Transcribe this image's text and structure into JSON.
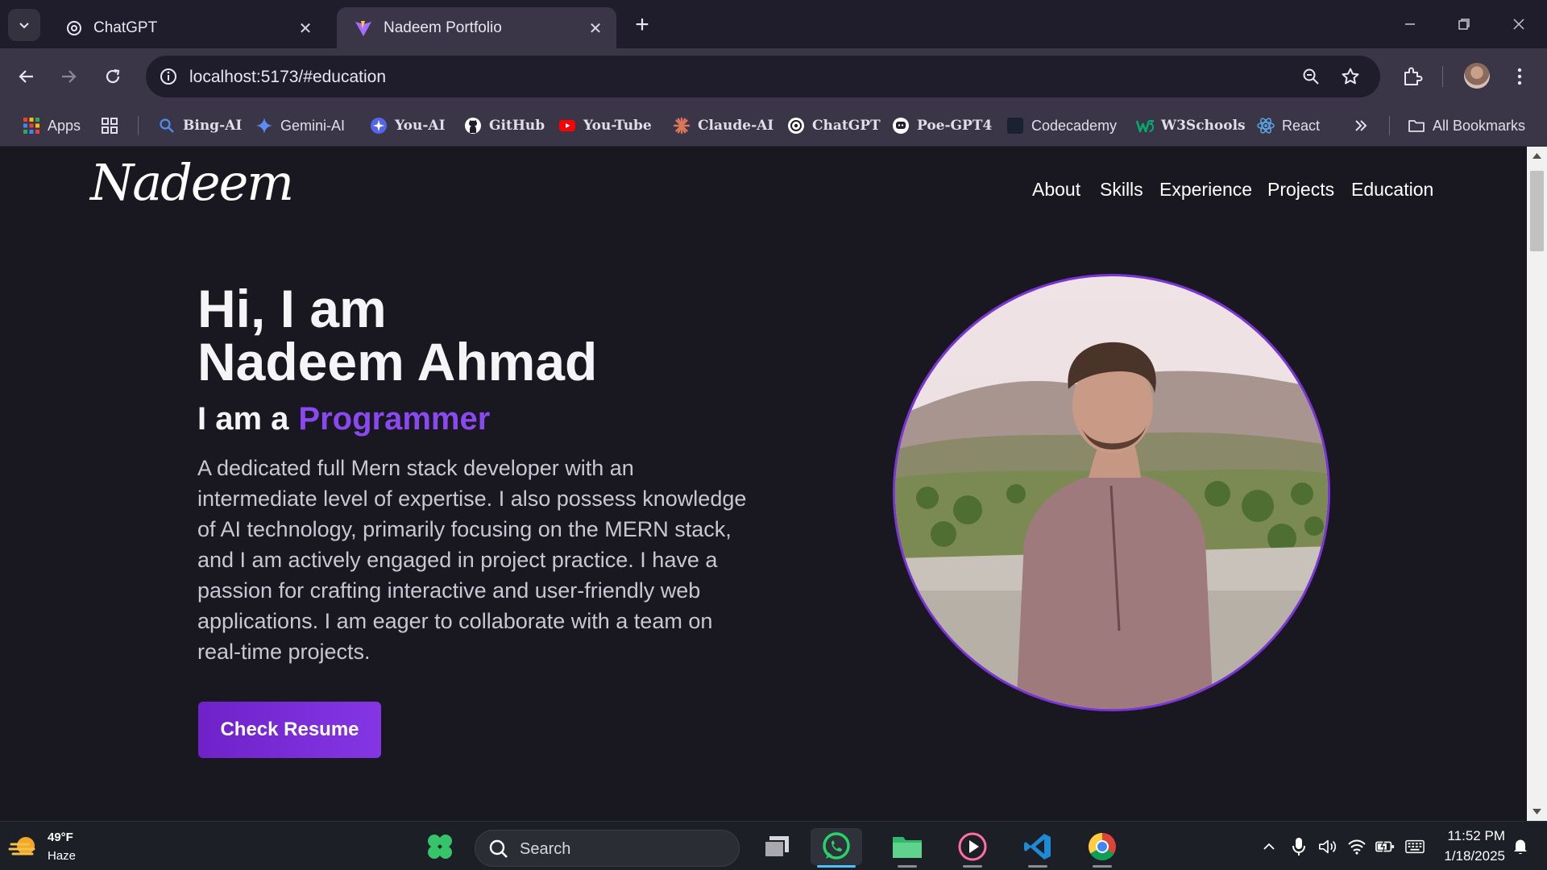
{
  "tabs": [
    {
      "title": "ChatGPT",
      "icon": "chatgpt-icon",
      "active": false
    },
    {
      "title": "Nadeem Portfolio",
      "icon": "vite-icon",
      "active": true
    }
  ],
  "address_bar": {
    "url": "localhost:5173/#education"
  },
  "bookmarks": [
    {
      "label": "Apps",
      "icon": "apps-grid-icon"
    },
    {
      "label": "Bing-AI",
      "icon": "search-icon"
    },
    {
      "label": "Gemini-AI",
      "icon": "gemini-icon"
    },
    {
      "label": "You-AI",
      "icon": "you-icon"
    },
    {
      "label": "GitHub",
      "icon": "github-icon"
    },
    {
      "label": "You-Tube",
      "icon": "youtube-icon"
    },
    {
      "label": "Claude-AI",
      "icon": "claude-icon"
    },
    {
      "label": "ChatGPT",
      "icon": "chatgpt-icon"
    },
    {
      "label": "Poe-GPT4",
      "icon": "poe-icon"
    },
    {
      "label": "Codecademy",
      "icon": "codecademy-icon"
    },
    {
      "label": "W3Schools",
      "icon": "w3schools-icon"
    },
    {
      "label": "React",
      "icon": "react-icon"
    },
    {
      "label": "All Bookmarks",
      "icon": "folder-icon"
    }
  ],
  "site": {
    "logo": "Nadeem",
    "nav": [
      "About",
      "Skills",
      "Experience",
      "Projects",
      "Education"
    ],
    "hero": {
      "line1": "Hi, I am",
      "line2": "Nadeem Ahmad",
      "subtitle_prefix": "I am a",
      "role": "Programmer",
      "description": "A dedicated full Mern stack developer with an intermediate level of expertise. I also possess knowledge of AI technology, primarily focusing on the MERN stack, and I am actively engaged in project practice. I have a passion for crafting interactive and user-friendly web applications. I am eager to collaborate with a team on real-time projects.",
      "button": "Check Resume"
    },
    "accent_color": "#8a48f0"
  },
  "taskbar": {
    "weather": {
      "temp": "49°F",
      "desc": "Haze"
    },
    "search_label": "Search",
    "apps": [
      "task-view-icon",
      "whatsapp-icon",
      "file-explorer-icon",
      "media-player-icon",
      "vscode-icon",
      "chrome-icon"
    ],
    "clock": {
      "time": "11:52 PM",
      "date": "1/18/2025"
    }
  }
}
